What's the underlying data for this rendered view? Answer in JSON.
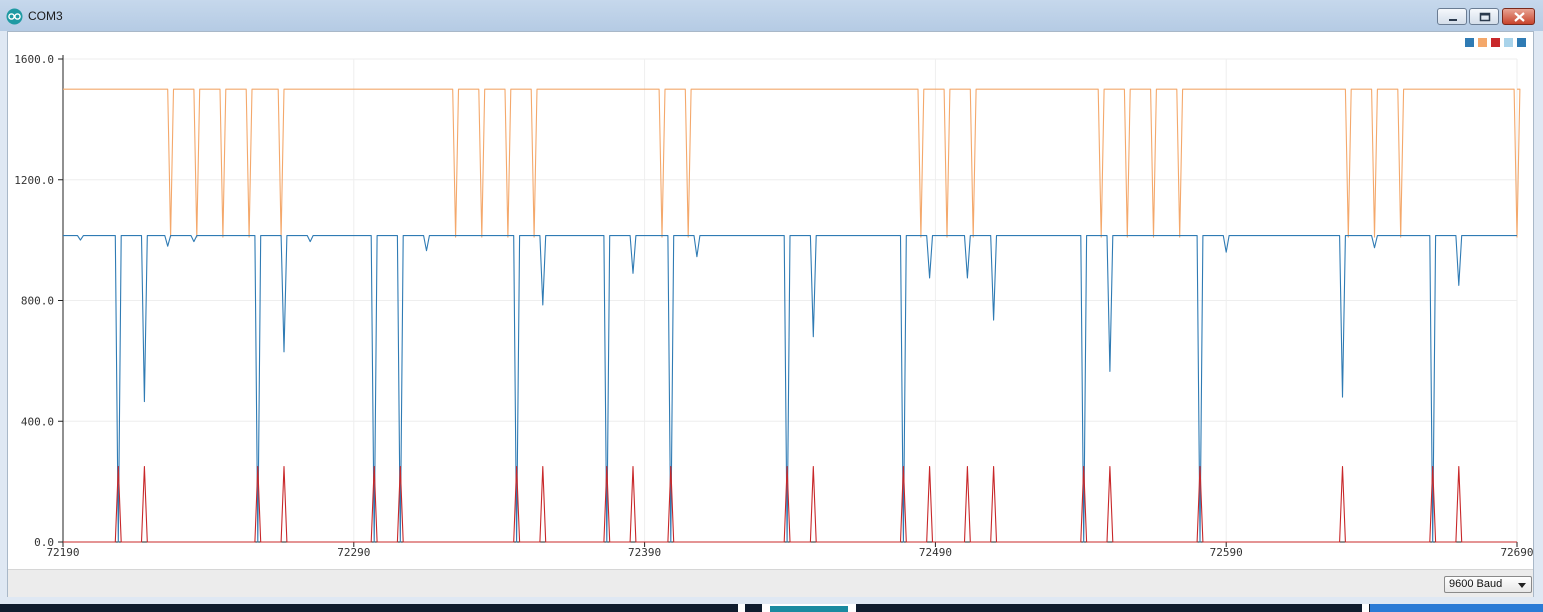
{
  "window": {
    "title": "COM3",
    "app_icon": "arduino-icon",
    "controls": [
      "minimize-icon",
      "maximize-icon",
      "close-icon"
    ]
  },
  "legend": {
    "swatches": [
      "#2f7bb4",
      "#f4a86b",
      "#c8282a",
      "#a9d3ea",
      "#2f7bb4"
    ]
  },
  "footer": {
    "baud_label": "9600 Baud"
  },
  "chart_data": {
    "type": "line",
    "xlim": [
      72190,
      72690
    ],
    "ylim": [
      0,
      1600
    ],
    "x_ticks": [
      72190,
      72290,
      72390,
      72490,
      72590,
      72690
    ],
    "x_tick_labels": [
      "72190",
      "72290",
      "72390",
      "72490",
      "72590",
      "72690"
    ],
    "y_ticks": [
      0,
      400,
      800,
      1200,
      1600
    ],
    "y_tick_labels": [
      "0.0",
      "400.0",
      "800.0",
      "1200.0",
      "1600.0"
    ],
    "grid": true,
    "legend": "top-right",
    "series": [
      {
        "color": "#2f7bb4",
        "baseline": 1015,
        "dips": [
          {
            "x": 72196,
            "v": 1000
          },
          {
            "x": 72209,
            "v": 0
          },
          {
            "x": 72218,
            "v": 465
          },
          {
            "x": 72226,
            "v": 980
          },
          {
            "x": 72235,
            "v": 995
          },
          {
            "x": 72257,
            "v": 0
          },
          {
            "x": 72266,
            "v": 630
          },
          {
            "x": 72275,
            "v": 995
          },
          {
            "x": 72297,
            "v": 0
          },
          {
            "x": 72306,
            "v": 0
          },
          {
            "x": 72315,
            "v": 965
          },
          {
            "x": 72346,
            "v": 0
          },
          {
            "x": 72355,
            "v": 785
          },
          {
            "x": 72377,
            "v": 0
          },
          {
            "x": 72386,
            "v": 890
          },
          {
            "x": 72399,
            "v": 0
          },
          {
            "x": 72408,
            "v": 945
          },
          {
            "x": 72439,
            "v": 0
          },
          {
            "x": 72448,
            "v": 680
          },
          {
            "x": 72479,
            "v": 0
          },
          {
            "x": 72488,
            "v": 875
          },
          {
            "x": 72501,
            "v": 875
          },
          {
            "x": 72510,
            "v": 735
          },
          {
            "x": 72541,
            "v": 0
          },
          {
            "x": 72550,
            "v": 565
          },
          {
            "x": 72581,
            "v": 0
          },
          {
            "x": 72590,
            "v": 960
          },
          {
            "x": 72630,
            "v": 480
          },
          {
            "x": 72641,
            "v": 975
          },
          {
            "x": 72661,
            "v": 0
          },
          {
            "x": 72670,
            "v": 850
          }
        ]
      },
      {
        "color": "#f4a86b",
        "baseline": 1500,
        "dips": [
          {
            "x": 72227,
            "v": 1010
          },
          {
            "x": 72236,
            "v": 1010
          },
          {
            "x": 72245,
            "v": 1010
          },
          {
            "x": 72254,
            "v": 1010
          },
          {
            "x": 72265,
            "v": 1010
          },
          {
            "x": 72325,
            "v": 1010
          },
          {
            "x": 72334,
            "v": 1010
          },
          {
            "x": 72343,
            "v": 1010
          },
          {
            "x": 72352,
            "v": 1010
          },
          {
            "x": 72396,
            "v": 1010
          },
          {
            "x": 72405,
            "v": 1010
          },
          {
            "x": 72485,
            "v": 1010
          },
          {
            "x": 72494,
            "v": 1010
          },
          {
            "x": 72503,
            "v": 1010
          },
          {
            "x": 72547,
            "v": 1010
          },
          {
            "x": 72556,
            "v": 1010
          },
          {
            "x": 72565,
            "v": 1010
          },
          {
            "x": 72574,
            "v": 1010
          },
          {
            "x": 72632,
            "v": 1010
          },
          {
            "x": 72641,
            "v": 1010
          },
          {
            "x": 72650,
            "v": 1010
          },
          {
            "x": 72690,
            "v": 1010
          }
        ]
      },
      {
        "color": "#c8282a",
        "baseline": 0,
        "spikes": [
          72209,
          72218,
          72257,
          72266,
          72297,
          72306,
          72346,
          72355,
          72377,
          72386,
          72399,
          72439,
          72448,
          72479,
          72488,
          72501,
          72510,
          72541,
          72550,
          72581,
          72630,
          72661,
          72670
        ],
        "spike_value": 250
      }
    ]
  }
}
